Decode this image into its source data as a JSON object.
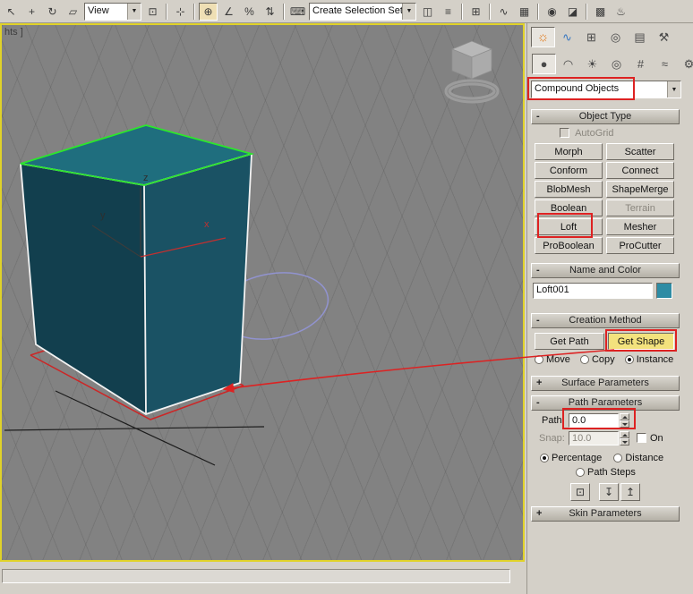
{
  "toolbar": {
    "coordinate_system": "View",
    "selection_set_placeholder": "Create Selection Set",
    "icons": [
      {
        "name": "select-object",
        "glyph": "↖"
      },
      {
        "name": "select-and-move",
        "glyph": "+"
      },
      {
        "name": "select-and-rotate",
        "glyph": "↻"
      },
      {
        "name": "select-and-scale",
        "glyph": "▱"
      },
      {
        "name": "use-pivot-point-center",
        "glyph": "⊡"
      },
      {
        "name": "select-and-manipulate",
        "glyph": "⊹"
      },
      {
        "name": "snap-toggle",
        "glyph": "⊕"
      },
      {
        "name": "angle-snap",
        "glyph": "∠"
      },
      {
        "name": "percent-snap",
        "glyph": "%"
      },
      {
        "name": "spinner-snap",
        "glyph": "⇅"
      },
      {
        "name": "keyboard-shortcut-override",
        "glyph": "⌨"
      },
      {
        "name": "mirror",
        "glyph": "◫"
      },
      {
        "name": "align",
        "glyph": "≡"
      },
      {
        "name": "layer-manager",
        "glyph": "⊞"
      },
      {
        "name": "curve-editor",
        "glyph": "∿"
      },
      {
        "name": "schematic-view",
        "glyph": "▦"
      },
      {
        "name": "material-editor",
        "glyph": "◉"
      },
      {
        "name": "render-setup",
        "glyph": "◪"
      },
      {
        "name": "render-frame",
        "glyph": "▩"
      },
      {
        "name": "quick-render",
        "glyph": "♨"
      }
    ]
  },
  "viewport": {
    "label": "hts ]",
    "axis_x": "x",
    "axis_y": "y",
    "axis_z": "z"
  },
  "command_panel": {
    "tabs": [
      {
        "name": "create",
        "glyph": "☼"
      },
      {
        "name": "modify",
        "glyph": "∿"
      },
      {
        "name": "hierarchy",
        "glyph": "⊞"
      },
      {
        "name": "motion",
        "glyph": "◎"
      },
      {
        "name": "display",
        "glyph": "▤"
      },
      {
        "name": "utilities",
        "glyph": "⚒"
      }
    ],
    "categories": [
      {
        "name": "geometry",
        "glyph": "●"
      },
      {
        "name": "shapes",
        "glyph": "◠"
      },
      {
        "name": "lights",
        "glyph": "☀"
      },
      {
        "name": "cameras",
        "glyph": "◎"
      },
      {
        "name": "helpers",
        "glyph": "#"
      },
      {
        "name": "space-warps",
        "glyph": "≈"
      },
      {
        "name": "systems",
        "glyph": "⚙"
      }
    ],
    "subcategory": "Compound Objects",
    "object_type": {
      "title": "Object Type",
      "sign": "-",
      "autogrid": "AutoGrid",
      "buttons": [
        "Morph",
        "Scatter",
        "Conform",
        "Connect",
        "BlobMesh",
        "ShapeMerge",
        "Boolean",
        "Terrain",
        "Loft",
        "Mesher",
        "ProBoolean",
        "ProCutter"
      ]
    },
    "name_and_color": {
      "title": "Name and Color",
      "sign": "-",
      "object_name": "Loft001"
    },
    "creation_method": {
      "title": "Creation Method",
      "sign": "-",
      "get_path": "Get Path",
      "get_shape": "Get Shape",
      "move": "Move",
      "copy": "Copy",
      "instance": "Instance"
    },
    "surface_parameters": {
      "title": "Surface Parameters",
      "sign": "+"
    },
    "path_parameters": {
      "title": "Path Parameters",
      "sign": "-",
      "path_label": "Path:",
      "path_value": "0.0",
      "snap_label": "Snap:",
      "snap_value": "10.0",
      "on_label": "On",
      "percentage": "Percentage",
      "distance": "Distance",
      "path_steps": "Path Steps",
      "pick_icons": [
        {
          "name": "pick-shape",
          "glyph": "⊡"
        },
        {
          "name": "previous-shape",
          "glyph": "↧"
        },
        {
          "name": "next-shape",
          "glyph": "↥"
        }
      ]
    },
    "skin_parameters": {
      "title": "Skin Parameters",
      "sign": "+"
    }
  },
  "colors": {
    "annotation_red": "#dd2222",
    "cube_top": "#1f6e7e",
    "cube_left": "#123f4e",
    "cube_right": "#1a5264",
    "shape_green": "#2ce62c",
    "path_red": "#cc2626",
    "circle_purple": "#9193cf",
    "name_swatch": "#2e8ca4",
    "viewport_border": "#e0d229"
  }
}
